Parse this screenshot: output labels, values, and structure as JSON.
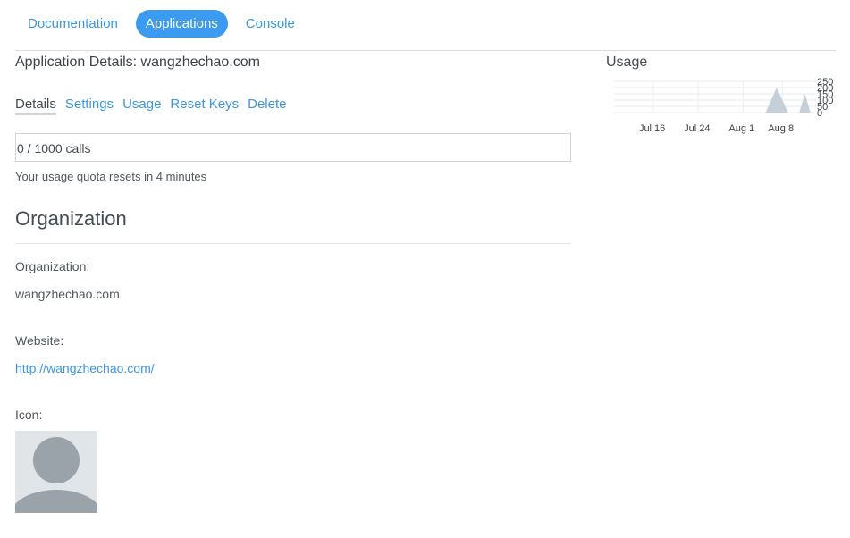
{
  "topnav": {
    "items": [
      {
        "label": "Documentation",
        "active": false
      },
      {
        "label": "Applications",
        "active": true
      },
      {
        "label": "Console",
        "active": false
      }
    ]
  },
  "app": {
    "title": "Application Details: wangzhechao.com"
  },
  "subtabs": {
    "items": [
      {
        "label": "Details",
        "active": true
      },
      {
        "label": "Settings",
        "active": false
      },
      {
        "label": "Usage",
        "active": false
      },
      {
        "label": "Reset Keys",
        "active": false
      },
      {
        "label": "Delete",
        "active": false
      }
    ]
  },
  "quota": {
    "calls": "0 / 1000 calls",
    "reset_note": "Your usage quota resets in 4 minutes"
  },
  "organization": {
    "section_title": "Organization",
    "org_label": "Organization:",
    "org_value": "wangzhechao.com",
    "website_label": "Website:",
    "website_value": "http://wangzhechao.com/",
    "icon_label": "Icon:",
    "icon_name": "default-user-avatar-icon"
  },
  "usage": {
    "title": "Usage"
  },
  "chart_data": {
    "type": "area",
    "title": "",
    "xlabel": "",
    "ylabel": "",
    "x_ticks": [
      "Jul 16",
      "Jul 24",
      "Aug 1",
      "Aug 8"
    ],
    "y_ticks": [
      "250",
      "200",
      "150",
      "100",
      "50",
      "0"
    ],
    "ylim": [
      0,
      250
    ],
    "grid": true,
    "series": [
      {
        "color": "#c5cfd9",
        "points": [
          [
            "Aug 5",
            0
          ],
          [
            "Aug 7",
            200
          ],
          [
            "Aug 9",
            0
          ],
          [
            "Aug 11",
            0
          ],
          [
            "Aug 12",
            150
          ],
          [
            "Aug 13",
            0
          ]
        ]
      }
    ]
  },
  "colors": {
    "accent": "#3a9bf0",
    "link": "#3a97e0",
    "text": "#444b52",
    "rule": "#d8dcdf",
    "chart_fill": "#c5cfd9",
    "avatar_bg": "#e1e5e8",
    "avatar_fg": "#9aa3aa"
  }
}
